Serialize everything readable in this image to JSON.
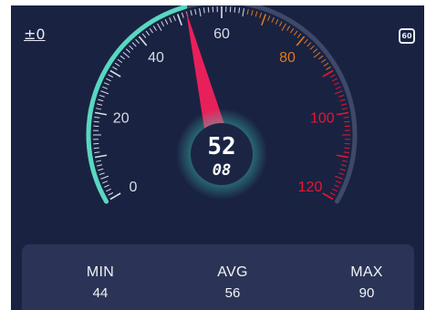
{
  "header": {
    "calibrate_label": "±0",
    "limit_badge": "60"
  },
  "gauge": {
    "max_speed": 120,
    "current_value": 52,
    "colors": {
      "track": "#3e4868",
      "progress": "#58d8c0",
      "ticks_normal": "#d8dce6",
      "ticks_warn": "#e07818",
      "ticks_danger": "#e81630",
      "needle": "#e8205a"
    },
    "scale_labels": [
      {
        "value": 0,
        "text": "0",
        "color": "#d8dce6"
      },
      {
        "value": 20,
        "text": "20",
        "color": "#d8dce6"
      },
      {
        "value": 40,
        "text": "40",
        "color": "#d8dce6"
      },
      {
        "value": 60,
        "text": "60",
        "color": "#d8dce6"
      },
      {
        "value": 80,
        "text": "80",
        "color": "#e07818"
      },
      {
        "value": 100,
        "text": "100",
        "color": "#e81630"
      },
      {
        "value": 120,
        "text": "120",
        "color": "#e81630"
      }
    ],
    "readout_main": "52",
    "readout_sub": "08"
  },
  "stats": {
    "min": {
      "label": "MIN",
      "value": "44"
    },
    "avg": {
      "label": "AVG",
      "value": "56"
    },
    "max": {
      "label": "MAX",
      "value": "90"
    }
  }
}
